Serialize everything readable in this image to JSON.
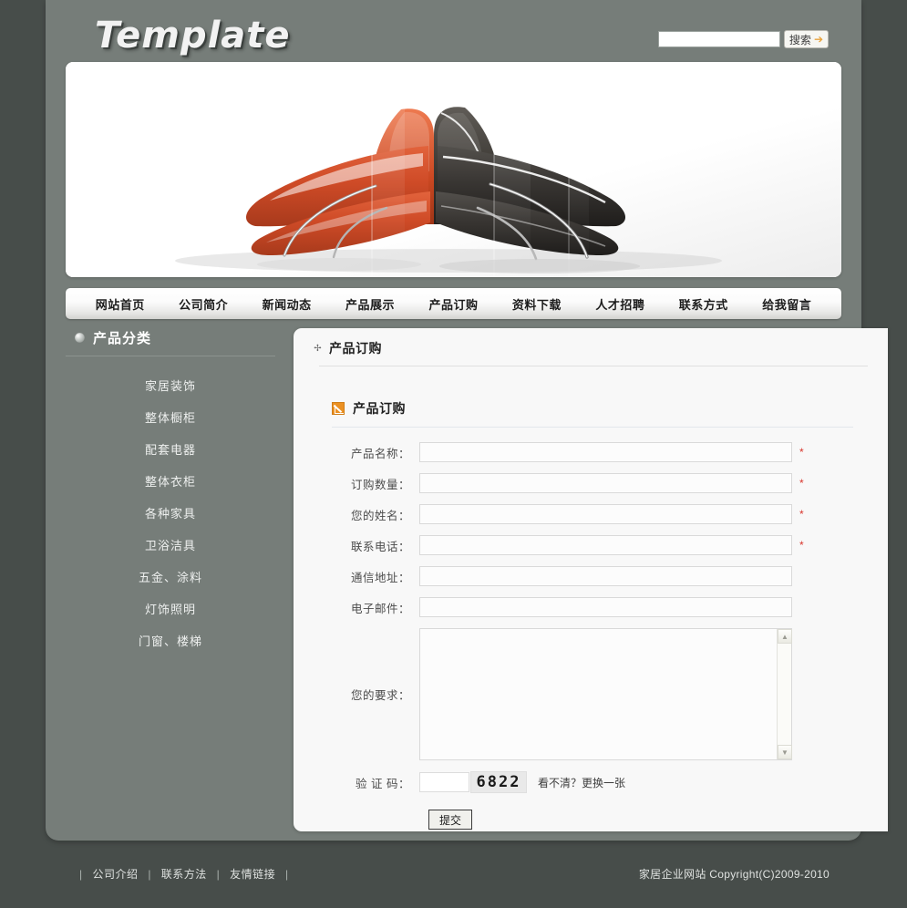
{
  "header": {
    "logo": "Template",
    "search": {
      "value": "",
      "placeholder": "",
      "button_label": "搜索",
      "arrow_icon": "arrow-right-icon"
    }
  },
  "nav": {
    "items": [
      {
        "label": "网站首页"
      },
      {
        "label": "公司简介"
      },
      {
        "label": "新闻动态"
      },
      {
        "label": "产品展示"
      },
      {
        "label": "产品订购"
      },
      {
        "label": "资料下载"
      },
      {
        "label": "人才招聘"
      },
      {
        "label": "联系方式"
      },
      {
        "label": "给我留言"
      }
    ]
  },
  "banner": {
    "alt": "two-chaise-lounge-chairs",
    "colors": {
      "chair_left": "#d2502f",
      "chair_right": "#3a3734",
      "background": "#ffffff"
    }
  },
  "sidebar": {
    "title": "产品分类",
    "items": [
      {
        "label": "家居装饰"
      },
      {
        "label": "整体橱柜"
      },
      {
        "label": "配套电器"
      },
      {
        "label": "整体衣柜"
      },
      {
        "label": "各种家具"
      },
      {
        "label": "卫浴洁具"
      },
      {
        "label": "五金、涂料"
      },
      {
        "label": "灯饰照明"
      },
      {
        "label": "门窗、楼梯"
      }
    ]
  },
  "content": {
    "breadcrumb": "产品订购",
    "section_title": "产品订购",
    "form": {
      "fields": [
        {
          "label": "产品名称：",
          "value": "",
          "required": true,
          "mark": "*"
        },
        {
          "label": "订购数量：",
          "value": "",
          "required": true,
          "mark": "*"
        },
        {
          "label": "您的姓名：",
          "value": "",
          "required": true,
          "mark": "*"
        },
        {
          "label": "联系电话：",
          "value": "",
          "required": true,
          "mark": "*"
        },
        {
          "label": "通信地址：",
          "value": "",
          "required": false,
          "mark": ""
        },
        {
          "label": "电子邮件：",
          "value": "",
          "required": false,
          "mark": ""
        }
      ],
      "textarea": {
        "label": "您的要求：",
        "value": ""
      },
      "captcha": {
        "label": "验 证 码：",
        "value": "",
        "code": "6822",
        "refresh_text": "看不清？更换一张"
      },
      "submit_label": "提交"
    }
  },
  "footer": {
    "links": [
      {
        "label": "公司介绍"
      },
      {
        "label": "联系方法"
      },
      {
        "label": "友情链接"
      }
    ],
    "copyright": "家居企业网站  Copyright(C)2009-2010"
  },
  "colors": {
    "page_bg": "#474d4a",
    "shell_bg": "#767d79",
    "accent_orange": "#eb9123",
    "required_red": "#d9342b"
  }
}
